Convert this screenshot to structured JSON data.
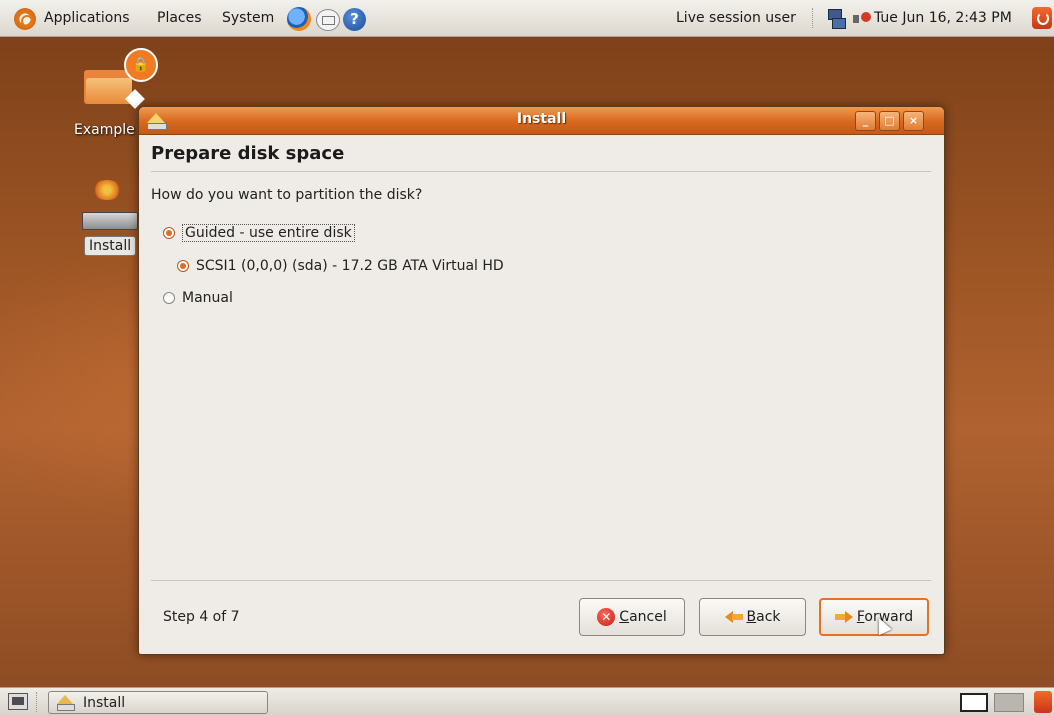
{
  "top_panel": {
    "menus": [
      "Applications",
      "Places",
      "System"
    ],
    "user": "Live session user",
    "datetime": "Tue Jun 16,  2:43 PM"
  },
  "desktop": {
    "examples_label": "Example",
    "install_label": "Install"
  },
  "window": {
    "title": "Install",
    "heading": "Prepare disk space",
    "question": "How do you want to partition the disk?",
    "options": [
      {
        "label": "Guided - use entire disk",
        "selected": true
      },
      {
        "label": "SCSI1 (0,0,0) (sda) - 17.2 GB ATA Virtual HD",
        "selected": true
      },
      {
        "label": "Manual",
        "selected": false
      }
    ],
    "step": "Step 4 of 7",
    "buttons": {
      "cancel": {
        "mnemonic": "C",
        "rest": "ancel"
      },
      "back": {
        "mnemonic": "B",
        "rest": "ack"
      },
      "forward": {
        "mnemonic": "F",
        "rest": "orward"
      }
    },
    "controls": {
      "minimize": "_",
      "maximize": "□",
      "close": "×"
    }
  },
  "taskbar": {
    "task_label": "Install"
  },
  "colors": {
    "accent": "#e07328",
    "titlebar": "#d6681e",
    "window_bg": "#efebe7"
  }
}
